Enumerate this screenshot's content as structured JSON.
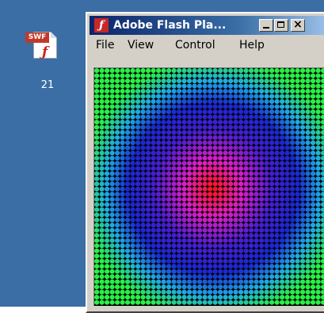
{
  "desktop": {
    "icon": {
      "badge": "SWF",
      "label": "21",
      "icon_name": "swf-file-icon"
    }
  },
  "window": {
    "title": "Adobe Flash Pla...",
    "app_icon_glyph": "ƒ",
    "controls": {
      "minimize_icon": "minimize-icon",
      "maximize_icon": "maximize-icon",
      "close_glyph": "×"
    }
  },
  "menu": {
    "items": [
      {
        "label": "File"
      },
      {
        "label": "View"
      },
      {
        "label": "Control"
      },
      {
        "label": "Help"
      }
    ]
  },
  "colors": {
    "desktop": "#3a6ea5",
    "titlebar_start": "#0a246a",
    "stage_bg": "#000000",
    "center": "#ff1a1a",
    "mid": "#1414c8",
    "edge": "#28f040"
  }
}
